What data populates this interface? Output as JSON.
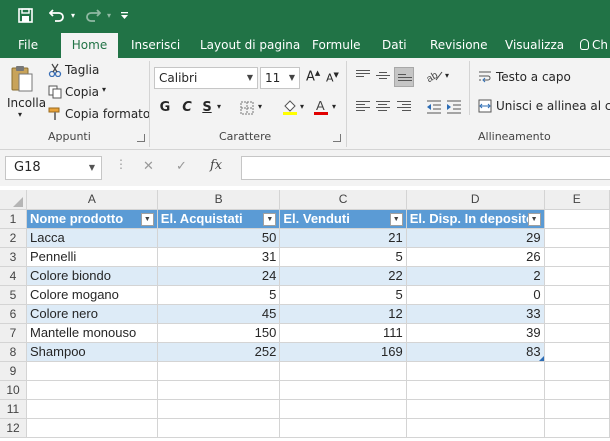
{
  "quick_access": {
    "save_icon": "save-icon",
    "undo_icon": "undo-icon",
    "redo_icon": "redo-icon",
    "customize_icon": "customize-icon"
  },
  "tabs": [
    "File",
    "Home",
    "Inserisci",
    "Layout di pagina",
    "Formule",
    "Dati",
    "Revisione",
    "Visualizza"
  ],
  "active_tab": "Home",
  "tell_me": "Ch",
  "ribbon": {
    "clipboard": {
      "paste": "Incolla",
      "cut": "Taglia",
      "copy": "Copia",
      "format_painter": "Copia formato",
      "group": "Appunti"
    },
    "font": {
      "name": "Calibri",
      "size": "11",
      "bold": "G",
      "italic": "C",
      "underline": "S",
      "group": "Carattere"
    },
    "alignment": {
      "wrap": "Testo a capo",
      "merge": "Unisci e allinea al centro",
      "group": "Allineamento"
    }
  },
  "formula_bar": {
    "name_box": "G18",
    "cancel": "✕",
    "enter": "✓",
    "fx": "fx",
    "value": ""
  },
  "columns": [
    "A",
    "B",
    "C",
    "D",
    "E"
  ],
  "row_numbers": [
    "1",
    "2",
    "3",
    "4",
    "5",
    "6",
    "7",
    "8",
    "9",
    "10",
    "11",
    "12"
  ],
  "table": {
    "headers": [
      "Nome prodotto",
      "El. Acquistati",
      "El. Venduti",
      "El. Disp. In deposito"
    ],
    "rows": [
      [
        "Lacca",
        "50",
        "21",
        "29"
      ],
      [
        "Pennelli",
        "31",
        "5",
        "26"
      ],
      [
        "Colore biondo",
        "24",
        "22",
        "2"
      ],
      [
        "Colore mogano",
        "5",
        "5",
        "0"
      ],
      [
        "Colore nero",
        "45",
        "12",
        "33"
      ],
      [
        "Mantelle monouso",
        "150",
        "111",
        "39"
      ],
      [
        "Shampoo",
        "252",
        "169",
        "83"
      ]
    ]
  },
  "colors": {
    "excel_green": "#217346",
    "header_blue": "#5b9bd5",
    "band_blue": "#ddebf7"
  }
}
